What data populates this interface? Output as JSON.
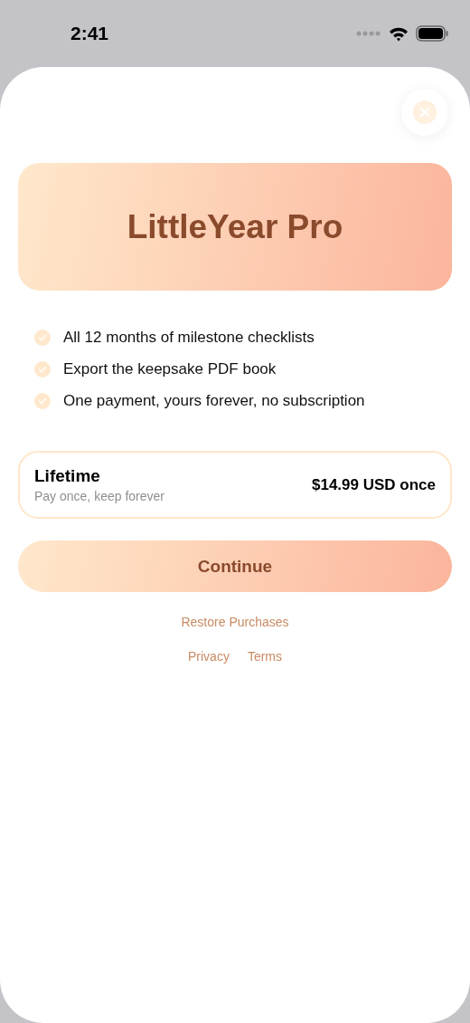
{
  "status_bar": {
    "time": "2:41"
  },
  "title": "LittleYear Pro",
  "features": [
    {
      "text": "All 12 months of milestone checklists",
      "checked": true
    },
    {
      "text": "Export the keepsake PDF book",
      "checked": true
    },
    {
      "text": "One payment, yours forever, no subscription",
      "checked": true
    }
  ],
  "plan": {
    "name": "Lifetime",
    "subtitle": "Pay once, keep forever",
    "price": "$14.99 USD once",
    "selected": true
  },
  "continue_button": "Continue",
  "restore_link": "Restore Purchases",
  "footer_links": [
    "Privacy",
    "Terms"
  ]
}
